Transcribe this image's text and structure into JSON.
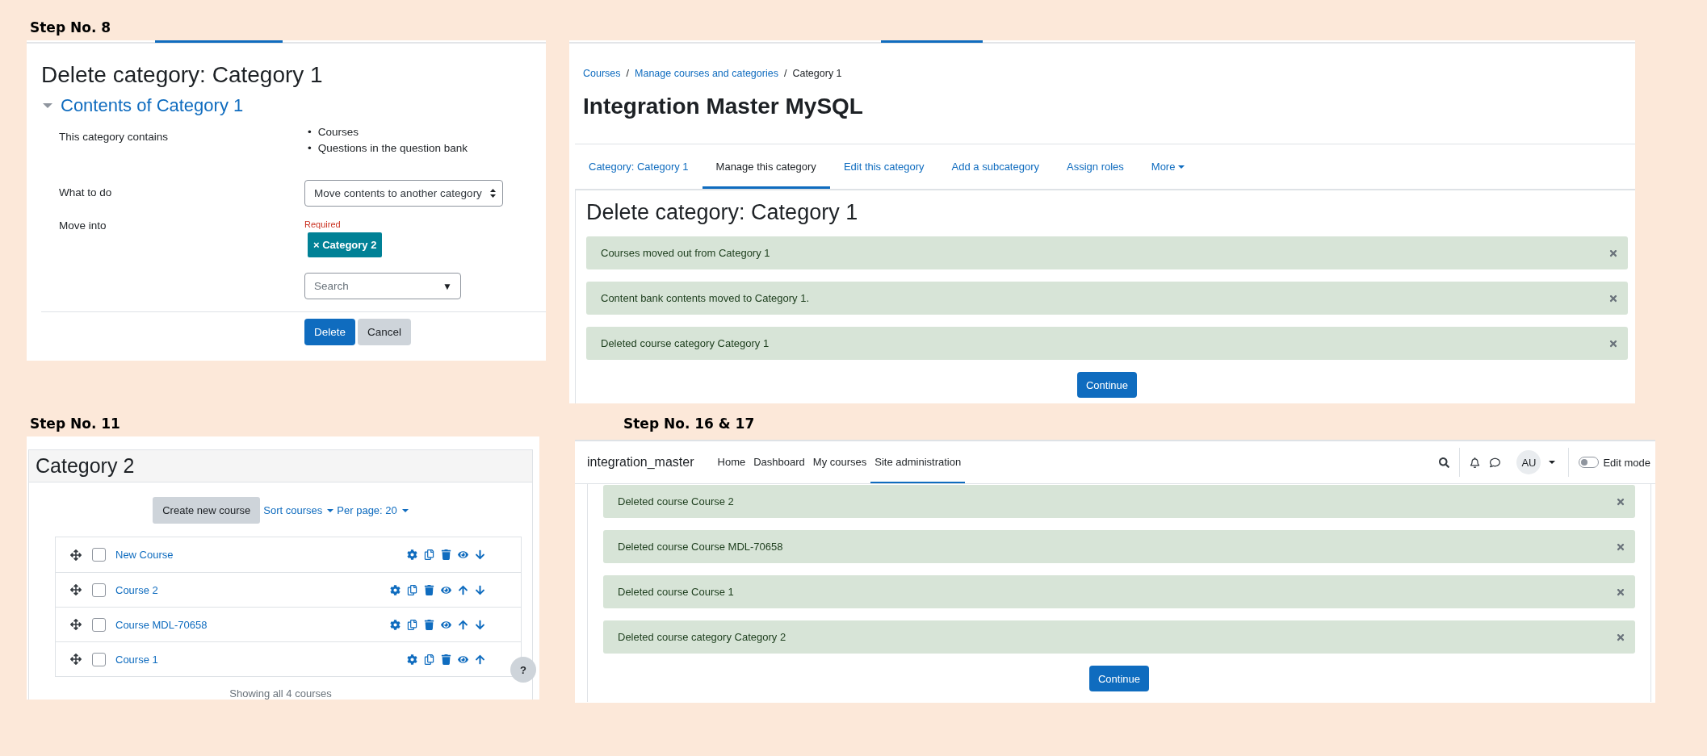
{
  "delete_form": {
    "step_label": "Step No. 8",
    "title": "Delete category: Category 1",
    "section_title": "Contents of Category 1",
    "section_expanded": true,
    "contains_label": "This category contains",
    "contains_items": [
      {
        "bullet": "•",
        "label": "Courses"
      },
      {
        "bullet": "•",
        "label": "Questions in the question bank"
      }
    ],
    "what_to_do_label": "What to do",
    "what_to_do_value": "Move contents to another category",
    "move_into_label": "Move into",
    "required_note": "Required",
    "selected_chips": [
      "× Category 2"
    ],
    "search": {
      "placeholder": "Search",
      "dropdown_glyph": "▼"
    },
    "buttons": [
      {
        "label": "Delete",
        "kind": "primary"
      },
      {
        "label": "Cancel",
        "kind": "secondary"
      }
    ]
  },
  "category_page": {
    "breadcrumbs": [
      {
        "label": "Courses",
        "kind": "link"
      },
      {
        "label": "/",
        "kind": "separator"
      },
      {
        "label": "Manage courses and categories",
        "kind": "link"
      },
      {
        "label": "/",
        "kind": "separator"
      },
      {
        "label": "Category 1",
        "kind": "current"
      }
    ],
    "site_title": "Integration Master MySQL",
    "tabs": [
      {
        "label": "Category: Category 1",
        "selected": false,
        "dropdown": false
      },
      {
        "label": "Manage this category",
        "selected": true,
        "dropdown": false
      },
      {
        "label": "Edit this category",
        "selected": false,
        "dropdown": false
      },
      {
        "label": "Add a subcategory",
        "selected": false,
        "dropdown": false
      },
      {
        "label": "Assign roles",
        "selected": false,
        "dropdown": false
      },
      {
        "label": "More",
        "selected": false,
        "dropdown": true
      }
    ],
    "heading": "Delete category: Category 1",
    "alerts": [
      "Courses moved out from Category 1",
      "Content bank contents moved to Category 1.",
      "Deleted course category Category 1"
    ],
    "continue": "Continue"
  },
  "course_list": {
    "step_label": "Step No. 11",
    "title": "Category 2",
    "create_button": "Create new course",
    "sort_menu": "Sort courses",
    "per_page_menu": "Per page: 20",
    "courses": [
      {
        "name": "New Course",
        "checked": false,
        "actions": [
          {
            "kind": "settings"
          },
          {
            "kind": "copy"
          },
          {
            "kind": "delete"
          },
          {
            "kind": "show"
          },
          {
            "kind": "down"
          }
        ]
      },
      {
        "name": "Course 2",
        "checked": false,
        "actions": [
          {
            "kind": "settings"
          },
          {
            "kind": "copy"
          },
          {
            "kind": "delete"
          },
          {
            "kind": "show"
          },
          {
            "kind": "up"
          },
          {
            "kind": "down"
          }
        ]
      },
      {
        "name": "Course MDL-70658",
        "checked": false,
        "actions": [
          {
            "kind": "settings"
          },
          {
            "kind": "copy"
          },
          {
            "kind": "delete"
          },
          {
            "kind": "show"
          },
          {
            "kind": "up"
          },
          {
            "kind": "down"
          }
        ]
      },
      {
        "name": "Course 1",
        "checked": false,
        "actions": [
          {
            "kind": "settings"
          },
          {
            "kind": "copy"
          },
          {
            "kind": "delete"
          },
          {
            "kind": "show"
          },
          {
            "kind": "up"
          }
        ]
      }
    ],
    "help_button": "?",
    "footer": "Showing all 4 courses"
  },
  "admin_page": {
    "step_label": "Step No. 16 & 17",
    "brand": "integration_master",
    "nav": [
      {
        "label": "Home",
        "selected": false
      },
      {
        "label": "Dashboard",
        "selected": false
      },
      {
        "label": "My courses",
        "selected": false
      },
      {
        "label": "Site administration",
        "selected": true
      }
    ],
    "avatar": "AU",
    "edit_mode": {
      "label": "Edit mode",
      "on": false
    },
    "alerts": [
      "Deleted course Course 2",
      "Deleted course Course MDL-70658",
      "Deleted course Course 1",
      "Deleted course category Category 2"
    ],
    "continue": "Continue"
  }
}
